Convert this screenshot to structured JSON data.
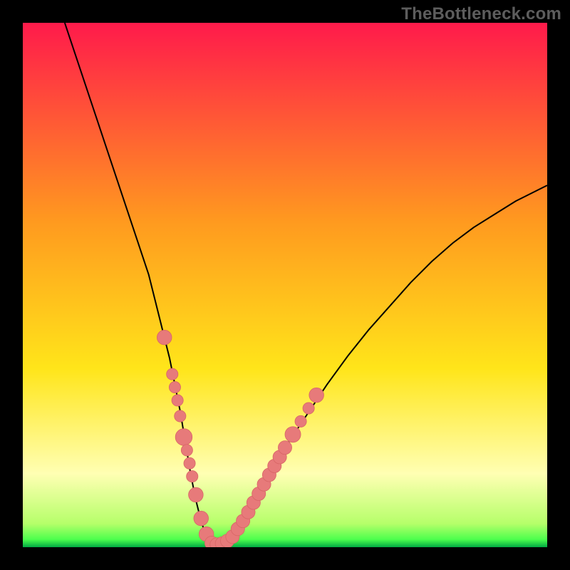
{
  "watermark": "TheBottleneck.com",
  "colors": {
    "gradient_top": "#ff1a4b",
    "gradient_mid1": "#ff9a1f",
    "gradient_mid2": "#ffe51a",
    "gradient_pale": "#ffffb3",
    "gradient_bottom_band": "#4dff4d",
    "gradient_bottom_edge": "#00aa44",
    "marker_fill": "#e77a7a",
    "marker_stroke": "#d86666",
    "curve_stroke": "#000000",
    "frame_bg": "#000000"
  },
  "chart_data": {
    "type": "line",
    "title": "",
    "xlabel": "",
    "ylabel": "",
    "xlim": [
      0,
      100
    ],
    "ylim": [
      0,
      100
    ],
    "y_inverted": false,
    "series": [
      {
        "name": "bottleneck-curve",
        "x": [
          8,
          10,
          12,
          14,
          16,
          18,
          20,
          22,
          24,
          26,
          27,
          28,
          29,
          30,
          31,
          32,
          33,
          34,
          35,
          36,
          37,
          38,
          40,
          42,
          44,
          46,
          48,
          50,
          54,
          58,
          62,
          66,
          70,
          74,
          78,
          82,
          86,
          90,
          94,
          98,
          100
        ],
        "y": [
          100,
          94,
          88,
          82,
          76,
          70,
          64,
          58,
          52,
          44,
          40,
          36,
          31,
          26,
          20,
          14,
          9,
          5,
          2,
          0.7,
          0.4,
          0.8,
          2,
          5,
          8.5,
          12,
          15.5,
          19,
          25,
          31,
          36.5,
          41.5,
          46,
          50.5,
          54.5,
          58,
          61,
          63.5,
          66,
          68,
          69
        ]
      }
    ],
    "markers": [
      {
        "x": 27.0,
        "y": 40.0,
        "r": 1.4
      },
      {
        "x": 28.5,
        "y": 33.0,
        "r": 1.1
      },
      {
        "x": 29.0,
        "y": 30.5,
        "r": 1.1
      },
      {
        "x": 29.5,
        "y": 28.0,
        "r": 1.1
      },
      {
        "x": 30.0,
        "y": 25.0,
        "r": 1.1
      },
      {
        "x": 30.7,
        "y": 21.0,
        "r": 1.6
      },
      {
        "x": 31.3,
        "y": 18.5,
        "r": 1.1
      },
      {
        "x": 31.8,
        "y": 16.0,
        "r": 1.1
      },
      {
        "x": 32.3,
        "y": 13.5,
        "r": 1.1
      },
      {
        "x": 33.0,
        "y": 10.0,
        "r": 1.4
      },
      {
        "x": 34.0,
        "y": 5.5,
        "r": 1.4
      },
      {
        "x": 35.0,
        "y": 2.5,
        "r": 1.4
      },
      {
        "x": 36.0,
        "y": 0.8,
        "r": 1.3
      },
      {
        "x": 37.0,
        "y": 0.5,
        "r": 1.3
      },
      {
        "x": 38.0,
        "y": 0.7,
        "r": 1.3
      },
      {
        "x": 39.0,
        "y": 1.2,
        "r": 1.3
      },
      {
        "x": 40.0,
        "y": 2.0,
        "r": 1.3
      },
      {
        "x": 41.0,
        "y": 3.5,
        "r": 1.3
      },
      {
        "x": 42.0,
        "y": 5.0,
        "r": 1.3
      },
      {
        "x": 43.0,
        "y": 6.7,
        "r": 1.3
      },
      {
        "x": 44.0,
        "y": 8.5,
        "r": 1.3
      },
      {
        "x": 45.0,
        "y": 10.2,
        "r": 1.3
      },
      {
        "x": 46.0,
        "y": 12.0,
        "r": 1.3
      },
      {
        "x": 47.0,
        "y": 13.8,
        "r": 1.3
      },
      {
        "x": 48.0,
        "y": 15.5,
        "r": 1.3
      },
      {
        "x": 49.0,
        "y": 17.2,
        "r": 1.3
      },
      {
        "x": 50.0,
        "y": 19.0,
        "r": 1.3
      },
      {
        "x": 51.5,
        "y": 21.5,
        "r": 1.5
      },
      {
        "x": 53.0,
        "y": 24.0,
        "r": 1.1
      },
      {
        "x": 54.5,
        "y": 26.5,
        "r": 1.1
      },
      {
        "x": 56.0,
        "y": 29.0,
        "r": 1.4
      }
    ],
    "legend": null,
    "grid": false
  }
}
